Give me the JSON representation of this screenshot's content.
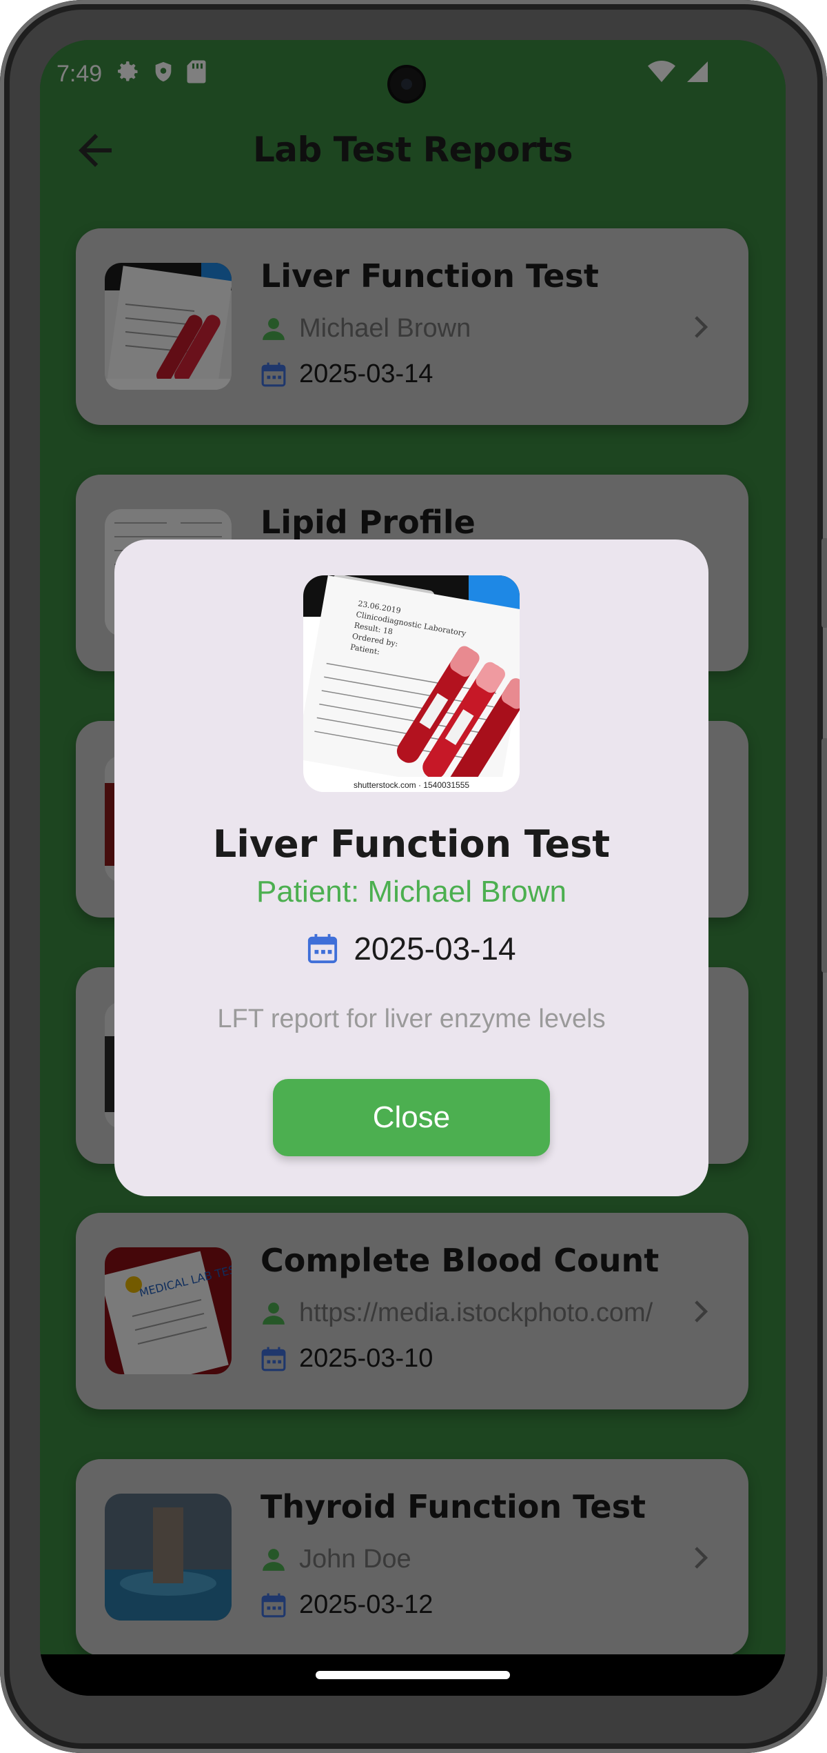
{
  "status_bar": {
    "time": "7:49"
  },
  "app_bar": {
    "title": "Lab Test Reports"
  },
  "reports": [
    {
      "title": "Liver Function Test",
      "patient": "Michael Brown",
      "date": "2025-03-14"
    },
    {
      "title": "Lipid Profile",
      "patient": "",
      "date": ""
    },
    {
      "title": "",
      "patient": "",
      "date": ""
    },
    {
      "title": "",
      "patient": "",
      "date": ""
    },
    {
      "title": "Complete Blood Count",
      "patient": "https://media.istockphoto.com/",
      "date": "2025-03-10"
    },
    {
      "title": "Thyroid Function Test",
      "patient": "John Doe",
      "date": "2025-03-12"
    }
  ],
  "dialog": {
    "title": "Liver Function Test",
    "patient": "Patient: Michael Brown",
    "date": "2025-03-14",
    "description": "LFT report for liver enzyme levels",
    "close_label": "Close",
    "image_watermark": "shutterstock.com · 1540031555"
  },
  "colors": {
    "accent": "#4caf50",
    "app_background": "#3a8a40",
    "dialog_bg": "#ebe5ee",
    "calendar_icon": "#3f6fd8"
  }
}
